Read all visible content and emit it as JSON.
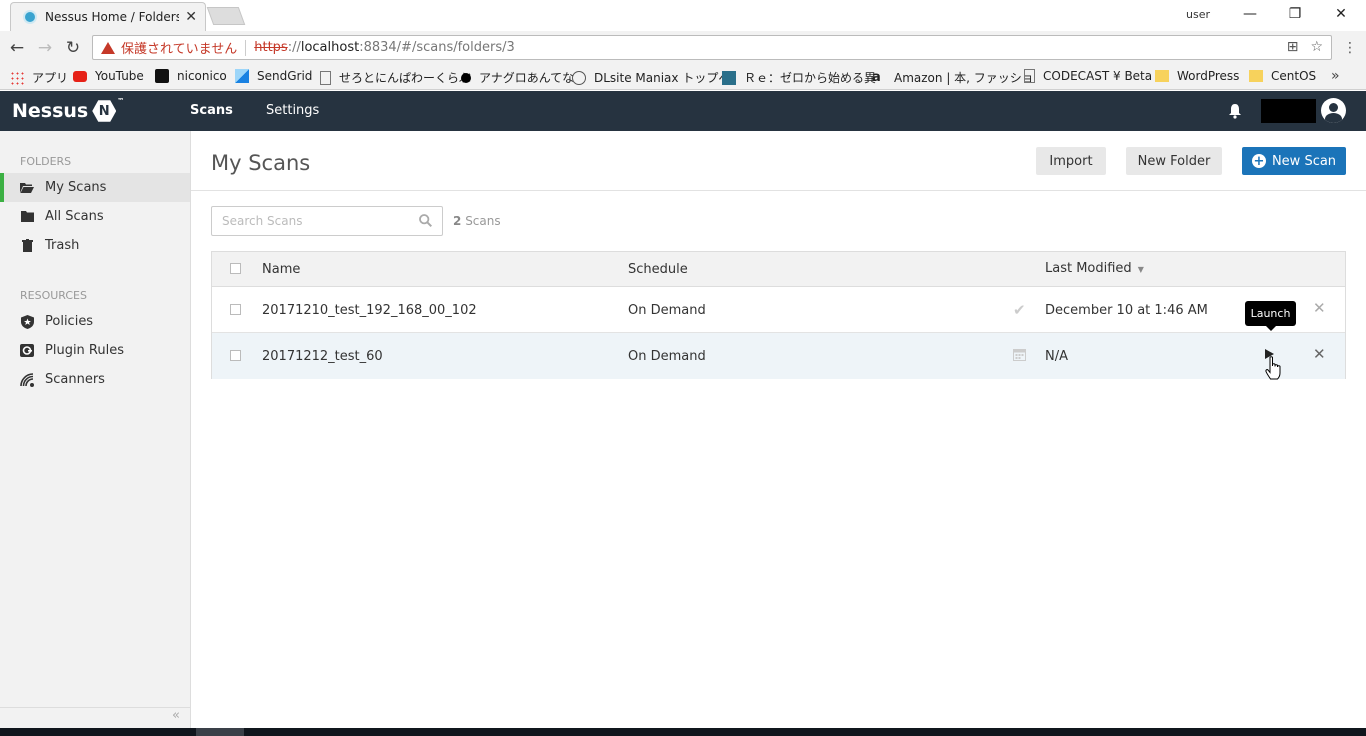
{
  "browser": {
    "tab_title": "Nessus Home / Folders /",
    "window_user": "user",
    "security_warning": "保護されていません",
    "url_protocol": "https",
    "url_separator": "://",
    "url_host": "localhost",
    "url_rest": ":8834/#/scans/folders/3",
    "bookmarks": [
      {
        "label": "アプリ",
        "icon": "apps-grid-icon"
      },
      {
        "label": "YouTube",
        "icon": "youtube-icon"
      },
      {
        "label": "niconico",
        "icon": "niconico-icon"
      },
      {
        "label": "SendGrid",
        "icon": "sendgrid-icon"
      },
      {
        "label": "せろとにんぱわーくらぶ",
        "icon": "page-icon"
      },
      {
        "label": "アナグロあんてな",
        "icon": "circle-icon"
      },
      {
        "label": "DLsite Maniax トップペ",
        "icon": "dlsite-icon"
      },
      {
        "label": "Ｒｅ：ゼロから始める異",
        "icon": "re-zero-icon"
      },
      {
        "label": "Amazon | 本, ファッショ",
        "icon": "amazon-icon"
      },
      {
        "label": "CODECAST ¥ Beta",
        "icon": "page-icon"
      },
      {
        "label": "WordPress",
        "icon": "folder-icon"
      },
      {
        "label": "CentOS",
        "icon": "folder-icon"
      }
    ]
  },
  "app": {
    "logo": "Nessus",
    "logo_mark": "N",
    "logo_tm": "™",
    "nav": {
      "scans": "Scans",
      "settings": "Settings"
    }
  },
  "sidebar": {
    "folders_heading": "FOLDERS",
    "folders": [
      {
        "label": "My Scans",
        "icon": "folder-open-icon",
        "active": true
      },
      {
        "label": "All Scans",
        "icon": "folder-icon",
        "active": false
      },
      {
        "label": "Trash",
        "icon": "trash-icon",
        "active": false
      }
    ],
    "resources_heading": "RESOURCES",
    "resources": [
      {
        "label": "Policies",
        "icon": "policies-icon"
      },
      {
        "label": "Plugin Rules",
        "icon": "plugin-rules-icon"
      },
      {
        "label": "Scanners",
        "icon": "scanners-icon"
      }
    ],
    "collapse": "«"
  },
  "main": {
    "title": "My Scans",
    "import_label": "Import",
    "new_folder_label": "New Folder",
    "new_scan_label": "New Scan",
    "search_placeholder": "Search Scans",
    "scan_count_number": "2",
    "scan_count_label": "Scans"
  },
  "table": {
    "columns": {
      "name": "Name",
      "schedule": "Schedule",
      "last_modified": "Last Modified"
    },
    "rows": [
      {
        "name": "20171210_test_192_168_00_102",
        "schedule": "On Demand",
        "status_icon": "check-icon",
        "last_modified": "December 10 at 1:46 AM"
      },
      {
        "name": "20171212_test_60",
        "schedule": "On Demand",
        "status_icon": "calendar-icon",
        "last_modified": "N/A"
      }
    ],
    "tooltip": "Launch"
  }
}
